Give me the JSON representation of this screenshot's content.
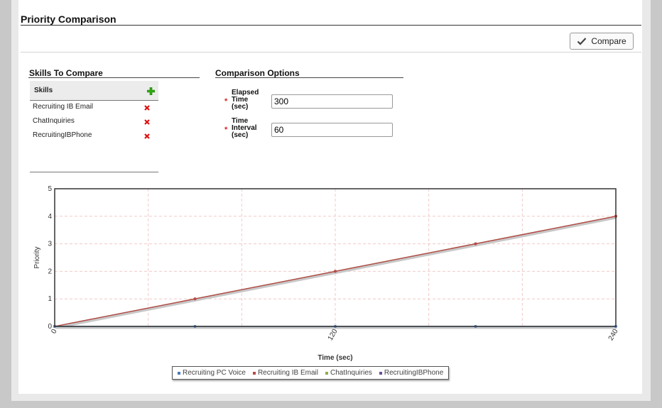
{
  "page": {
    "title": "Priority Comparison"
  },
  "toolbar": {
    "compare_label": "Compare",
    "compare_icon": "checkmark-icon"
  },
  "skills_panel": {
    "title": "Skills To Compare",
    "header": "Skills",
    "add_icon": "plus-icon",
    "remove_icon": "close-icon",
    "items": [
      {
        "label": "Recruiting IB Email"
      },
      {
        "label": "ChatInquiries"
      },
      {
        "label": "RecruitingIBPhone"
      }
    ]
  },
  "options_panel": {
    "title": "Comparison Options",
    "required_marker": "*",
    "elapsed": {
      "label_lines": [
        "Elapsed",
        "Time",
        "(sec)"
      ],
      "value": "300"
    },
    "interval": {
      "label_lines": [
        "Time",
        "Interval",
        "(sec)"
      ],
      "value": "60"
    }
  },
  "colors": {
    "add": "#33aa11",
    "remove": "#dd1111",
    "required": "#dd2222"
  },
  "chart_data": {
    "type": "line",
    "x": [
      0,
      60,
      120,
      180,
      240
    ],
    "x_tick_labels": [
      "0",
      "120",
      "240"
    ],
    "x_ticks": [
      0,
      120,
      240
    ],
    "xlabel": "Time (sec)",
    "ylabel": "Priority",
    "xlim": [
      0,
      240
    ],
    "ylim": [
      0,
      5
    ],
    "y_ticks": [
      0,
      1,
      2,
      3,
      4,
      5
    ],
    "grid": true,
    "legend_position": "bottom",
    "series": [
      {
        "name": "Recruiting PC Voice",
        "color": "#4a7ab8",
        "values": [
          0,
          0,
          0,
          0,
          0
        ]
      },
      {
        "name": "Recruiting IB Email",
        "color": "#b84a48",
        "values": [
          0,
          1,
          2,
          3,
          4
        ]
      },
      {
        "name": "ChatInquiries",
        "color": "#8cb04a",
        "values": [
          0,
          1,
          2,
          3,
          4
        ]
      },
      {
        "name": "RecruitingIBPhone",
        "color": "#6b4f95",
        "values": [
          0,
          1,
          2,
          3,
          4
        ]
      }
    ]
  }
}
